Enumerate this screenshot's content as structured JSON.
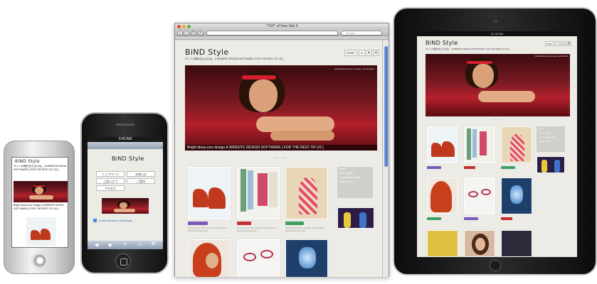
{
  "site": {
    "logo": "BiND Style",
    "tagline_jp": "サイトの顔を支えるのは、A WEBSITE DESIGN SOFTWARE [ FOR THE REST OF US ]",
    "caption": "Bright ideas,nice design.A WEBSITE DESIGN SOFTWARE [ FOR THE REST OF US ]",
    "photo_credit": "(c)2010istockphoto.com/jane merrifieldcha",
    "slide_dots": "• • • •",
    "lorem": "Lorem ipsum dolor sit amet the industry's standard dummy text",
    "tags": [
      "Lorem Ipsum",
      "Nature",
      "Lorem Ipsum"
    ],
    "sidenav": [
      "home",
      "Lorem ipsum",
      "Lorem ipsum dolor",
      "Lorem ipsum"
    ]
  },
  "small_phone": {
    "logo": "BiND Style",
    "line1": "サイトの顔を支えるのは、A WEBSITE DESIG",
    "line2": "SOFTWARE [ FOR THE REST OF US ]",
    "caption": "Bright ideas,nice design.A WEBSITE DESIG",
    "caption2": "SOFTWARE [ FOR THE REST OF US ]"
  },
  "iphone": {
    "status": "9:42 AM",
    "logo": "BiND Style",
    "menu": [
      "トップページ",
      "お知らせ",
      "ごあいさつ",
      "ご案内",
      "アクセス"
    ],
    "notice": "Lorem Ipsum is not simply"
  },
  "browser": {
    "window_title": "\"TOP\" of New Site 9",
    "search_placeholder": "Google",
    "logo": "BiND Style",
    "tagline": "サイトの顔を支えるのは、A WEBSITE DESIGN SOFTWARE [ FOR THE REST OF US ]",
    "font_buttons": [
      "PRINT",
      "A",
      "A",
      "A"
    ]
  },
  "ipad": {
    "status_time": "01:28 AM",
    "logo": "BiND Style",
    "tagline": "サイトの顔を支えるのは、A WEBSITE DESIGN SOFTWARE [ FOR THE REST OF US ]",
    "font_buttons": [
      "PRINT",
      "A",
      "A",
      "A"
    ]
  }
}
